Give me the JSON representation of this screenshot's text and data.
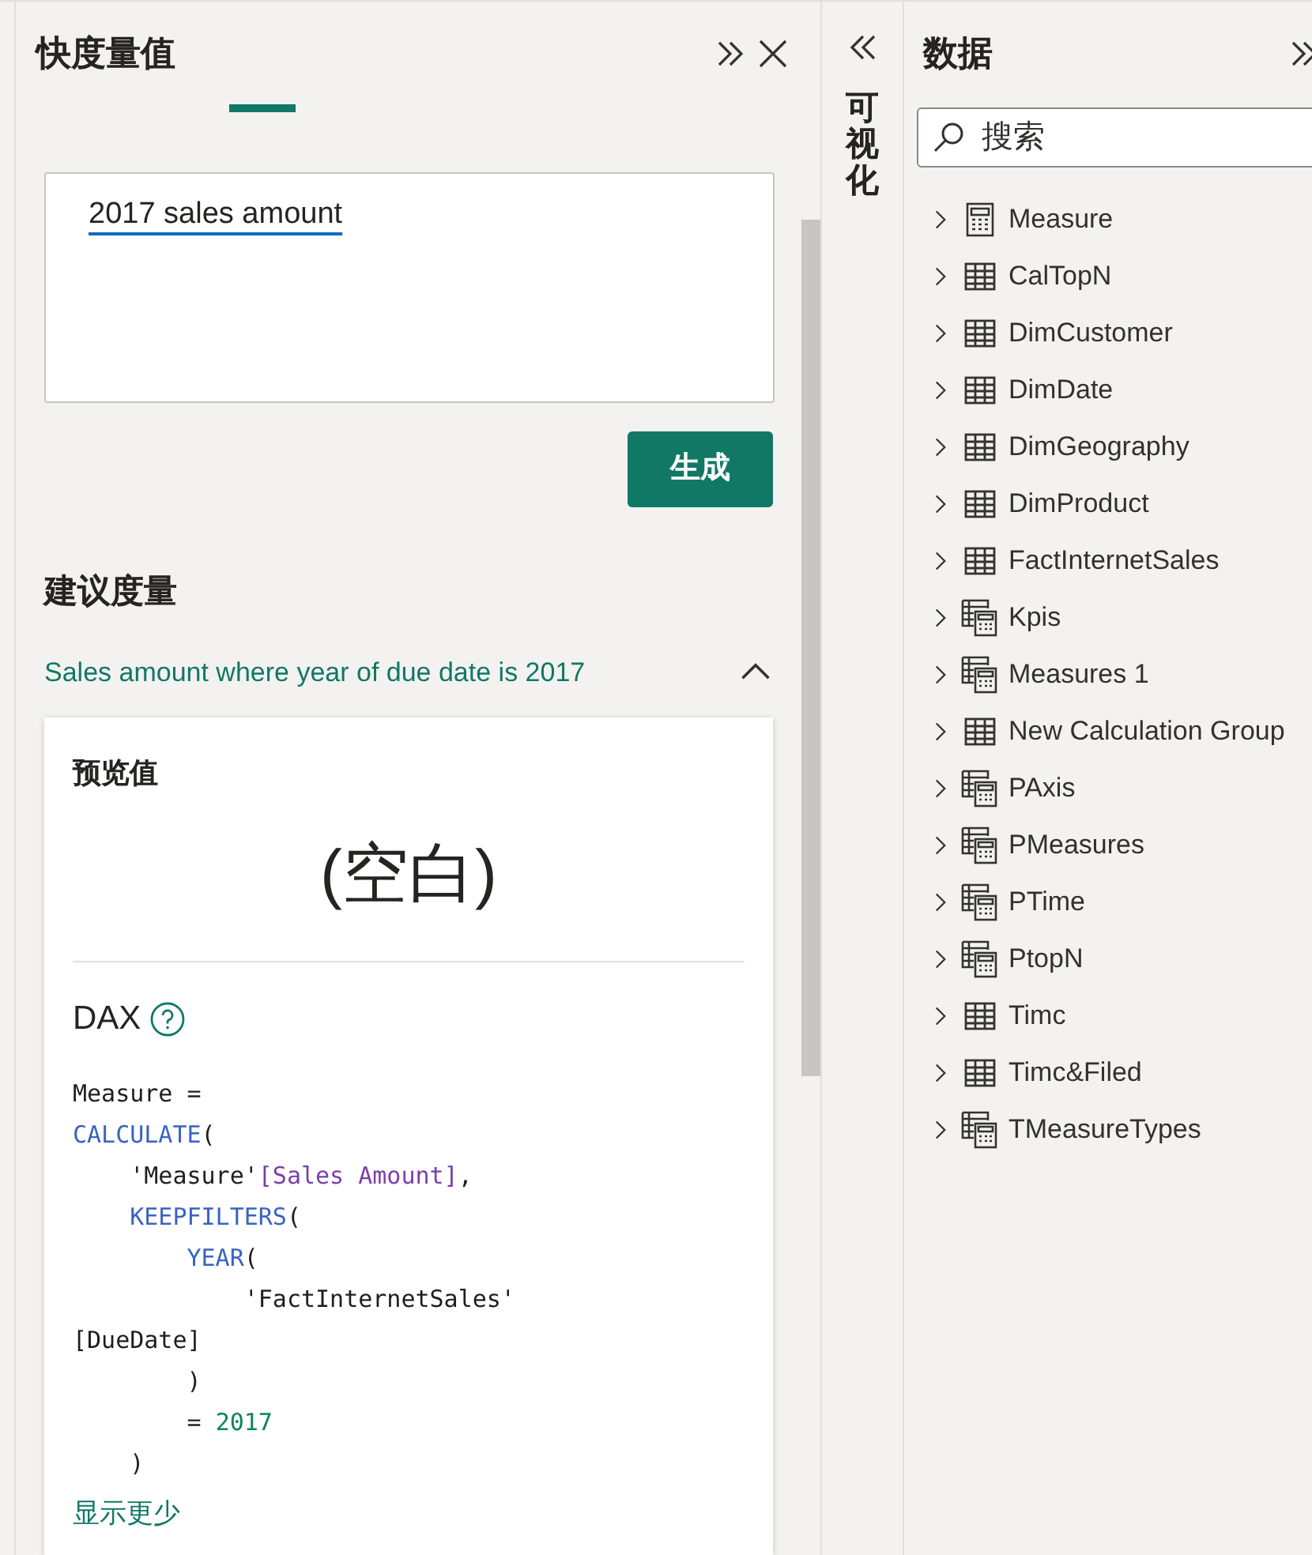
{
  "quick_measure_pane": {
    "title": "快度量值",
    "input": {
      "value": "2017 sales amount"
    },
    "generate_button": "生成",
    "suggestions_heading": "建议度量",
    "suggestion": {
      "label": "Sales amount where year of due date is 2017",
      "expanded": true,
      "preview_label": "预览值",
      "preview_value": "(空白)",
      "dax_label": "DAX",
      "code_lines": [
        [
          {
            "text": "Measure =",
            "kind": "plain"
          }
        ],
        [
          {
            "text": "CALCULATE",
            "kind": "function"
          },
          {
            "text": "(",
            "kind": "plain"
          }
        ],
        [
          {
            "text": "    'Measure'",
            "kind": "plain"
          },
          {
            "text": "[Sales Amount]",
            "kind": "measure"
          },
          {
            "text": ",",
            "kind": "plain"
          }
        ],
        [
          {
            "text": "    KEEPFILTERS",
            "kind": "function"
          },
          {
            "text": "(",
            "kind": "plain"
          }
        ],
        [
          {
            "text": "        YEAR",
            "kind": "function"
          },
          {
            "text": "(",
            "kind": "plain"
          }
        ],
        [
          {
            "text": "            'FactInternetSales'",
            "kind": "plain"
          }
        ],
        [
          {
            "text": "[DueDate]",
            "kind": "plain"
          }
        ],
        [
          {
            "text": "        )",
            "kind": "plain"
          }
        ],
        [
          {
            "text": "        = ",
            "kind": "plain"
          },
          {
            "text": "2017",
            "kind": "number"
          }
        ],
        [
          {
            "text": "    )",
            "kind": "plain"
          }
        ]
      ],
      "show_less_link": "显示更少"
    }
  },
  "visualizations_rail": {
    "label": "可视化"
  },
  "data_pane": {
    "title": "数据",
    "search": {
      "placeholder": "搜索"
    },
    "fields": [
      {
        "name": "Measure",
        "kind": "measure"
      },
      {
        "name": "CalTopN",
        "kind": "table"
      },
      {
        "name": "DimCustomer",
        "kind": "table"
      },
      {
        "name": "DimDate",
        "kind": "table"
      },
      {
        "name": "DimGeography",
        "kind": "table"
      },
      {
        "name": "DimProduct",
        "kind": "table"
      },
      {
        "name": "FactInternetSales",
        "kind": "table"
      },
      {
        "name": "Kpis",
        "kind": "mixed"
      },
      {
        "name": "Measures 1",
        "kind": "mixed"
      },
      {
        "name": "New Calculation Group",
        "kind": "table"
      },
      {
        "name": "PAxis",
        "kind": "mixed"
      },
      {
        "name": "PMeasures",
        "kind": "mixed"
      },
      {
        "name": "PTime",
        "kind": "mixed"
      },
      {
        "name": "PtopN",
        "kind": "mixed"
      },
      {
        "name": "Timc",
        "kind": "table"
      },
      {
        "name": "Timc&Filed",
        "kind": "table"
      },
      {
        "name": "TMeasureTypes",
        "kind": "mixed"
      }
    ]
  }
}
